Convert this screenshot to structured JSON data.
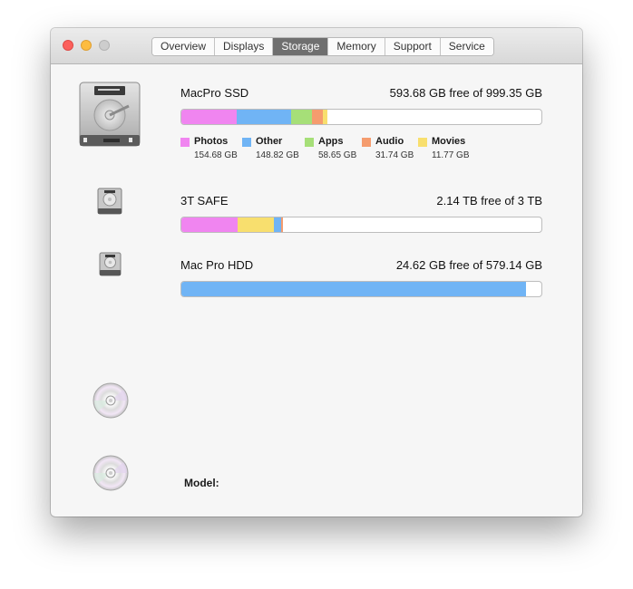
{
  "window": {
    "tabs": [
      {
        "label": "Overview",
        "active": false
      },
      {
        "label": "Displays",
        "active": false
      },
      {
        "label": "Storage",
        "active": true
      },
      {
        "label": "Memory",
        "active": false
      },
      {
        "label": "Support",
        "active": false
      },
      {
        "label": "Service",
        "active": false
      }
    ]
  },
  "drives": [
    {
      "name": "MacPro SSD",
      "free_text": "593.68 GB free of 999.35 GB",
      "icon": "hard-drive-icon",
      "segments": [
        {
          "category": "Photos",
          "size_gb": 154.68,
          "color": "#f085f0"
        },
        {
          "category": "Other",
          "size_gb": 148.82,
          "color": "#70b4f5"
        },
        {
          "category": "Apps",
          "size_gb": 58.65,
          "color": "#a6df78"
        },
        {
          "category": "Audio",
          "size_gb": 31.74,
          "color": "#f59c6e"
        },
        {
          "category": "Movies",
          "size_gb": 11.77,
          "color": "#f8df6e"
        }
      ],
      "legend": [
        {
          "label": "Photos",
          "size": "154.68 GB",
          "color": "#f085f0"
        },
        {
          "label": "Other",
          "size": "148.82 GB",
          "color": "#70b4f5"
        },
        {
          "label": "Apps",
          "size": "58.65 GB",
          "color": "#a6df78"
        },
        {
          "label": "Audio",
          "size": "31.74 GB",
          "color": "#f59c6e"
        },
        {
          "label": "Movies",
          "size": "11.77 GB",
          "color": "#f8df6e"
        }
      ]
    },
    {
      "name": "3T SAFE",
      "free_text": "2.14 TB free of 3 TB",
      "icon": "hard-drive-icon",
      "segments": [
        {
          "category": "Photos",
          "fraction": 0.157,
          "color": "#f085f0"
        },
        {
          "category": "Movies",
          "fraction": 0.099,
          "color": "#f8df6e"
        },
        {
          "category": "Other",
          "fraction": 0.022,
          "color": "#70b4f5"
        },
        {
          "category": "Audio",
          "fraction": 0.005,
          "color": "#f59c6e"
        }
      ]
    },
    {
      "name": "Mac Pro HDD",
      "free_text": "24.62 GB free of 579.14 GB",
      "icon": "hard-drive-icon",
      "segments": [
        {
          "category": "Other",
          "fraction": 0.957,
          "color": "#70b4f5"
        }
      ]
    }
  ],
  "optical_drives": [
    {
      "icon": "optical-disc-icon"
    },
    {
      "icon": "optical-disc-icon"
    }
  ],
  "model_label": "Model:"
}
